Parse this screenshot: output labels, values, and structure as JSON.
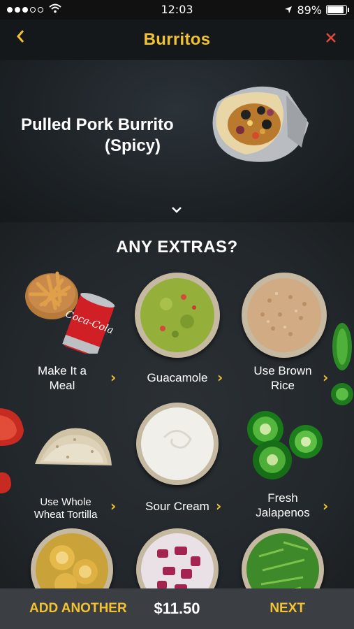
{
  "status": {
    "time": "12:03",
    "battery": "89%",
    "battery_level": 0.89
  },
  "nav": {
    "title": "Burritos",
    "back_icon": "chevron-left",
    "close_icon": "close-x"
  },
  "product": {
    "name_line1": "Pulled Pork Burrito",
    "name_line2": "(Spicy)"
  },
  "extras": {
    "title": "ANY EXTRAS?",
    "items": [
      {
        "label_line1": "Make It a",
        "label_line2": "Meal"
      },
      {
        "label_line1": "Guacamole",
        "label_line2": ""
      },
      {
        "label_line1": "Use Brown",
        "label_line2": "Rice"
      },
      {
        "label_line1": "Use Whole",
        "label_line2": "Wheat Tortilla"
      },
      {
        "label_line1": "Sour Cream",
        "label_line2": ""
      },
      {
        "label_line1": "Fresh",
        "label_line2": "Jalapenos"
      }
    ]
  },
  "footer": {
    "add_another": "ADD ANOTHER",
    "price": "$11.50",
    "next": "NEXT"
  },
  "colors": {
    "accent": "#f3c231",
    "close": "#e24a3b",
    "bottom_bar": "#3b3f43"
  }
}
